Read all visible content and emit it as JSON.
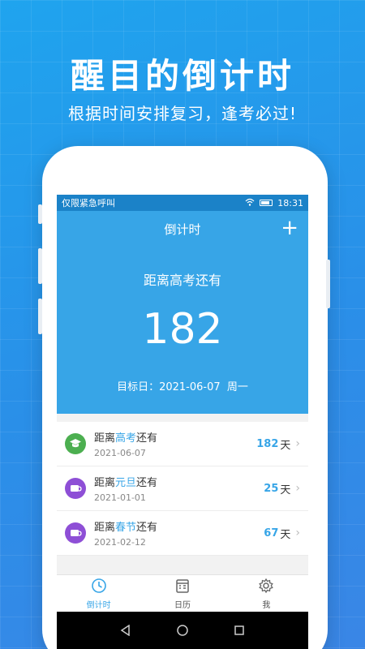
{
  "promo": {
    "headline": "醒目的倒计时",
    "subline": "根据时间安排复习，逢考必过!"
  },
  "statusbar": {
    "left_text": "仅限紧急呼叫",
    "time": "18:31"
  },
  "appbar": {
    "title": "倒计时",
    "add_symbol": "+"
  },
  "hero": {
    "title": "距离高考还有",
    "days": "182",
    "target_label": "目标日：",
    "target_date": "2021-06-07",
    "weekday": "周一"
  },
  "countdowns": [
    {
      "prefix": "距离",
      "event": "高考",
      "suffix": "还有",
      "date": "2021-06-07",
      "days": "182",
      "unit": "天",
      "icon": "graduation-cap-icon",
      "icon_color": "#4caf50"
    },
    {
      "prefix": "距离",
      "event": "元旦",
      "suffix": "还有",
      "date": "2021-01-01",
      "days": "25",
      "unit": "天",
      "icon": "cup-icon",
      "icon_color": "#8e4fd6"
    },
    {
      "prefix": "距离",
      "event": "春节",
      "suffix": "还有",
      "date": "2021-02-12",
      "days": "67",
      "unit": "天",
      "icon": "cup-icon",
      "icon_color": "#8e4fd6"
    }
  ],
  "tabs": [
    {
      "label": "倒计时",
      "icon": "clock-icon",
      "active": true
    },
    {
      "label": "日历",
      "icon": "calendar-icon",
      "active": false
    },
    {
      "label": "我",
      "icon": "gear-icon",
      "active": false
    }
  ],
  "colors": {
    "accent": "#37a5e7",
    "background": "#2a8fe8"
  }
}
